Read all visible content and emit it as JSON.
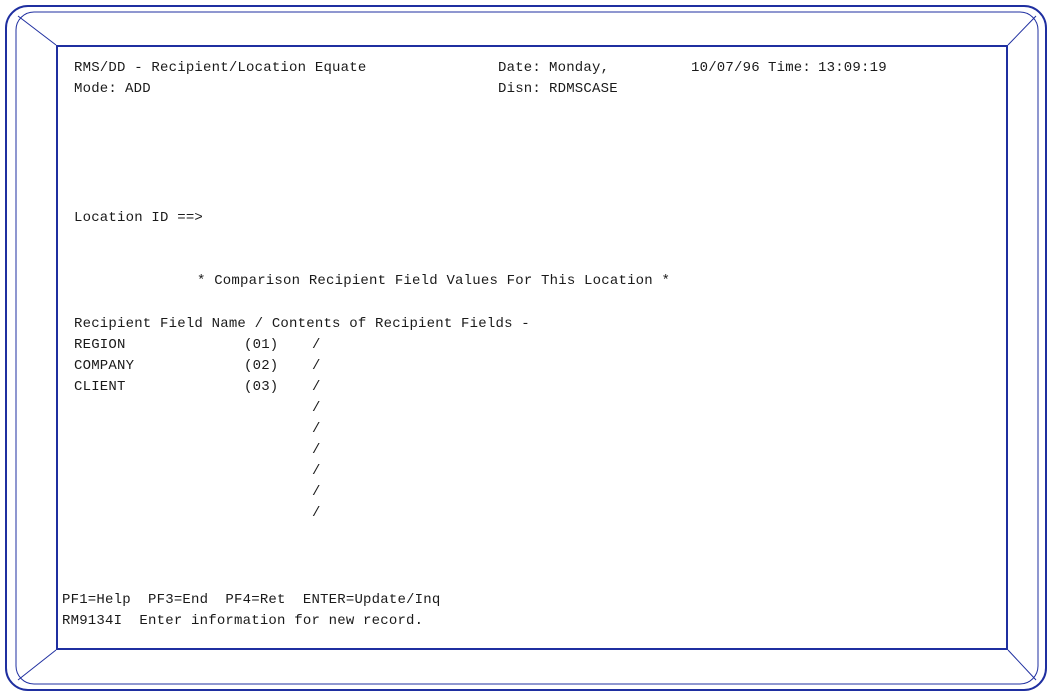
{
  "header": {
    "title": "RMS/DD - Recipient/Location Equate",
    "date_label": "Date:",
    "day": "Monday,",
    "date": "10/07/96",
    "time_label": "Time:",
    "time": "13:09:19",
    "mode_label": "Mode:",
    "mode": "ADD",
    "disn_label": "Disn:",
    "disn": "RDMSCASE"
  },
  "location": {
    "label": "Location ID ==>",
    "value": ""
  },
  "comparison_heading": "* Comparison Recipient Field Values For This Location *",
  "table": {
    "header": "Recipient Field Name / Contents of Recipient Fields -",
    "rows": [
      {
        "name": "REGION",
        "num": "(01)",
        "sep": "/",
        "value": ""
      },
      {
        "name": "COMPANY",
        "num": "(02)",
        "sep": "/",
        "value": ""
      },
      {
        "name": "CLIENT",
        "num": "(03)",
        "sep": "/",
        "value": ""
      },
      {
        "name": "",
        "num": "",
        "sep": "/",
        "value": ""
      },
      {
        "name": "",
        "num": "",
        "sep": "/",
        "value": ""
      },
      {
        "name": "",
        "num": "",
        "sep": "/",
        "value": ""
      },
      {
        "name": "",
        "num": "",
        "sep": "/",
        "value": ""
      },
      {
        "name": "",
        "num": "",
        "sep": "/",
        "value": ""
      },
      {
        "name": "",
        "num": "",
        "sep": "/",
        "value": ""
      }
    ]
  },
  "footer": {
    "pf_keys": "PF1=Help  PF3=End  PF4=Ret  ENTER=Update/Inq",
    "message": "RM9134I  Enter information for new record."
  },
  "colors": {
    "frame": "#1f2fa0",
    "text": "#1a1a1a"
  }
}
